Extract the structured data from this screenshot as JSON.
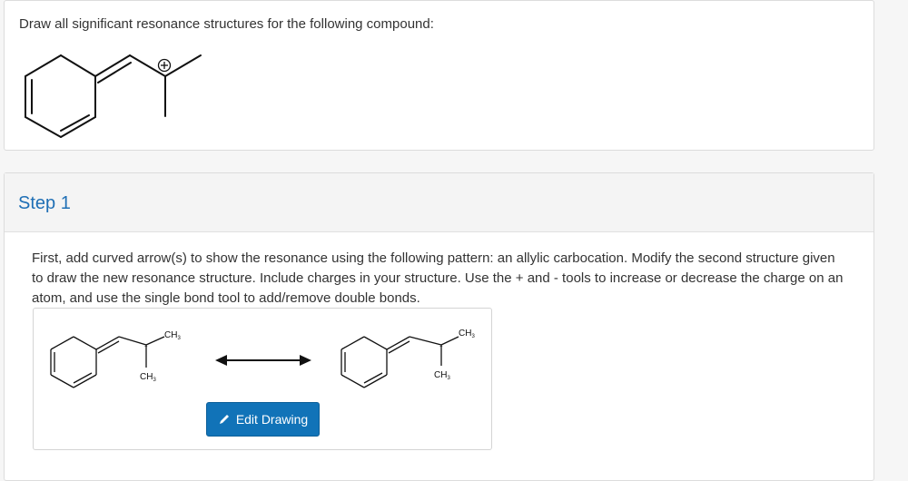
{
  "question": {
    "prompt": "Draw all significant resonance structures for the following compound:"
  },
  "step": {
    "title": "Step 1",
    "instructions": "First, add curved arrow(s) to show the resonance using the following pattern: an allylic carbocation. Modify the second structure given to draw the new resonance structure. Include charges in your structure. Use the + and - tools to increase or decrease the charge on an atom, and use the single bond tool to add/remove double bonds.",
    "structure_1": {
      "methyl_top": "CH",
      "methyl_bottom": "CH",
      "subscript": "3"
    },
    "structure_2": {
      "methyl_top": "CH",
      "methyl_bottom": "CH",
      "subscript": "3"
    },
    "edit_button_label": "Edit Drawing"
  },
  "icons": {
    "plus_charge": "plus-charge-icon",
    "resonance_arrow": "double-headed-arrow-icon",
    "edit": "pencil-icon"
  },
  "colors": {
    "accent": "#1173b8",
    "step_title": "#1f6fb5"
  }
}
